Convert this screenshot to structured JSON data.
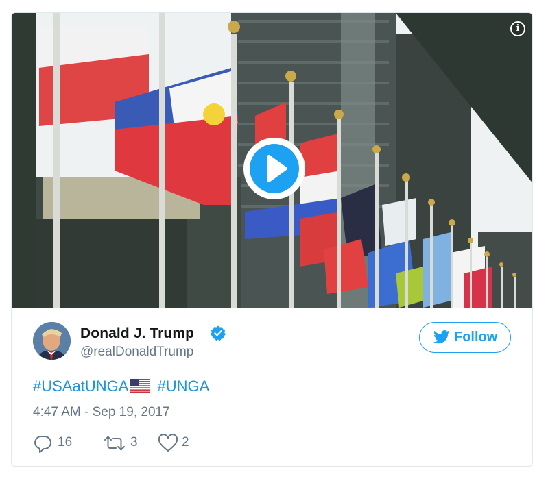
{
  "tweet": {
    "author_name": "Donald J. Trump",
    "author_handle": "@realDonaldTrump",
    "follow_label": "Follow",
    "hashtag_1": "#USAatUNGA",
    "hashtag_2": "#UNGA",
    "timestamp": "4:47 AM - Sep 19, 2017",
    "reply_count": "16",
    "retweet_count": "3",
    "like_count": "2"
  },
  "icons": {
    "info": "i",
    "play": "play-icon",
    "verified": "verified-badge-icon",
    "bird": "twitter-bird-icon",
    "reply": "reply-icon",
    "retweet": "retweet-icon",
    "like": "heart-icon",
    "flag": "us-flag-emoji"
  },
  "colors": {
    "accent": "#1da1f2",
    "hashtag": "#1b95e0",
    "muted": "#657786",
    "text": "#14171a"
  }
}
